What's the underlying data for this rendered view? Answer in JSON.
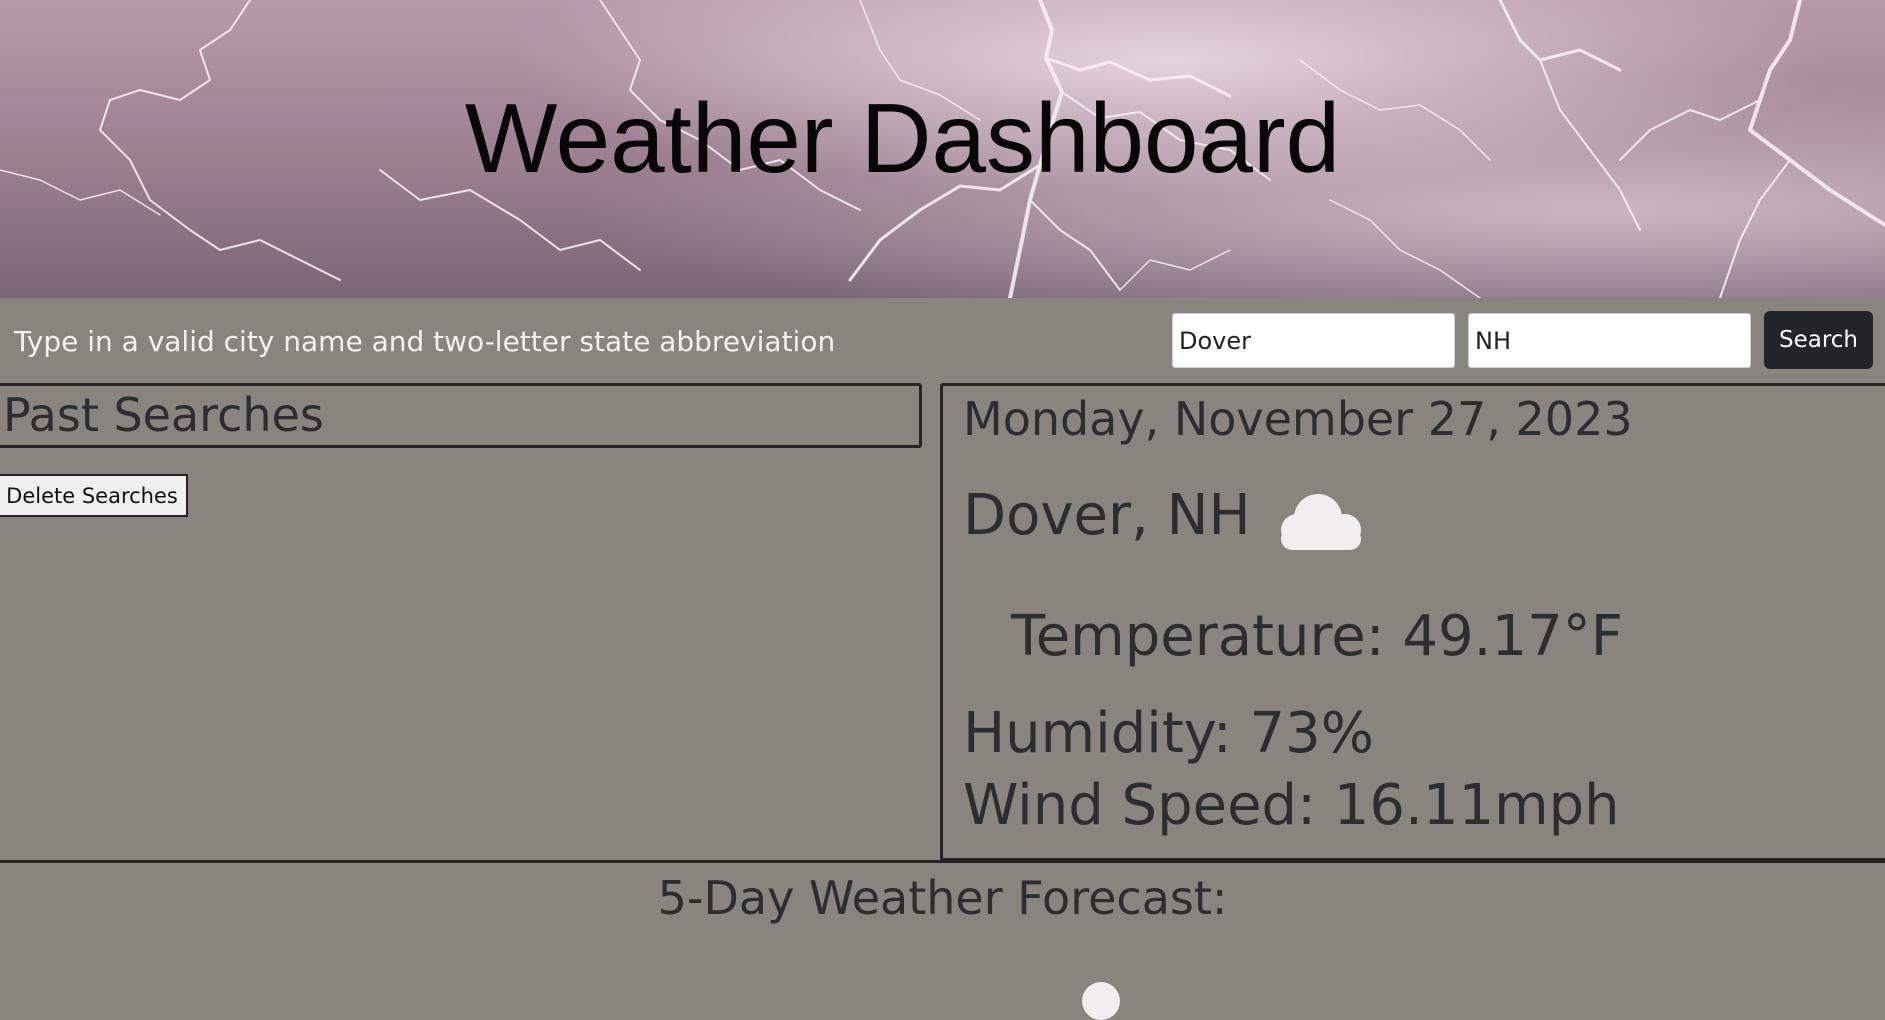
{
  "header": {
    "title": "Weather Dashboard"
  },
  "search": {
    "instruction": "Type in a valid city name and two-letter state abbreviation",
    "city_value": "Dover",
    "state_value": "NH",
    "button_label": "Search"
  },
  "past_searches": {
    "title": "Past Searches",
    "delete_label": "Delete Searches"
  },
  "current": {
    "date": "Monday, November 27, 2023",
    "location": "Dover, NH",
    "condition_icon": "cloud-icon",
    "temperature": "Temperature: 49.17°F",
    "humidity": "Humidity: 73%",
    "wind_speed": "Wind Speed: 16.11mph"
  },
  "forecast": {
    "title": "5-Day Weather Forecast:"
  },
  "colors": {
    "page_background": "#8a847f",
    "search_button": "#212529",
    "border": "#242424"
  }
}
